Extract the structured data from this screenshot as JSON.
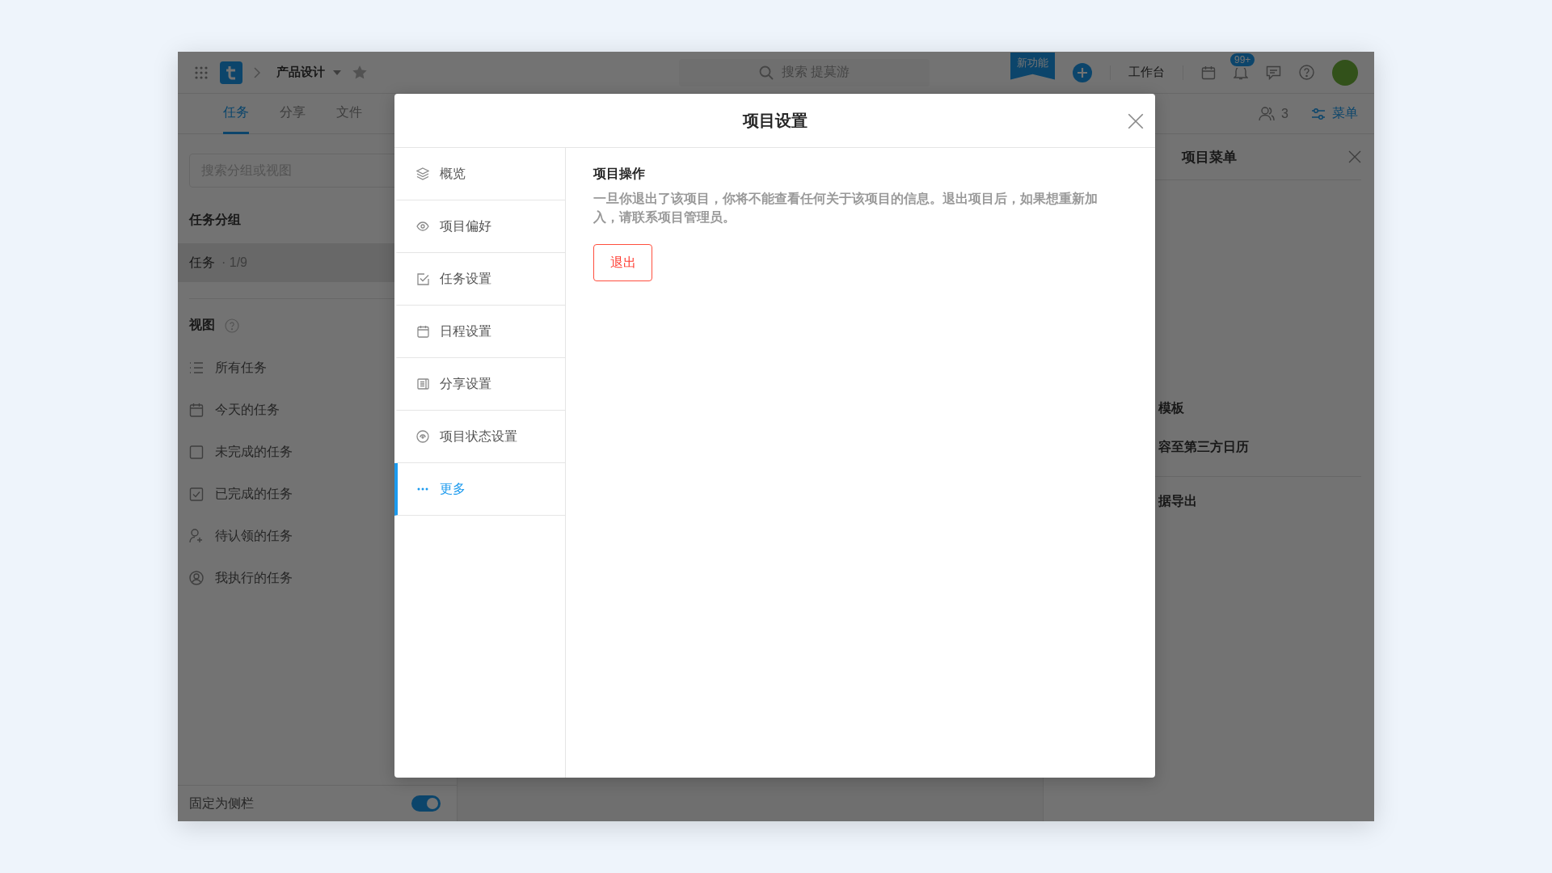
{
  "topbar": {
    "project_name": "产品设计",
    "search_placeholder": "搜索 提莫游",
    "new_feature_badge": "新功能",
    "workbench": "工作台",
    "notification_count": "99+"
  },
  "tabs": [
    {
      "label": "任务",
      "selected": true
    },
    {
      "label": "分享",
      "selected": false
    },
    {
      "label": "文件",
      "selected": false
    }
  ],
  "members_count": "3",
  "menu_button": "菜单",
  "sidebar": {
    "search": {
      "placeholder": "搜索分组或视图"
    },
    "groups_heading": "任务分组",
    "groups": [
      {
        "label": "任务",
        "count": "· 1/9",
        "selected": true
      }
    ],
    "views_heading": "视图",
    "views": [
      {
        "label": "所有任务",
        "kind": "list"
      },
      {
        "label": "今天的任务",
        "kind": "calendar"
      },
      {
        "label": "未完成的任务",
        "kind": "open"
      },
      {
        "label": "已完成的任务",
        "kind": "done"
      },
      {
        "label": "待认领的任务",
        "kind": "claim"
      },
      {
        "label": "我执行的任务",
        "kind": "mine"
      }
    ],
    "pin": {
      "label": "固定为侧栏",
      "on": true
    }
  },
  "menu_panel": {
    "title": "项目菜单",
    "items": [
      {
        "label": "模板"
      },
      {
        "label": "容至第三方日历"
      },
      {
        "label": "据导出"
      }
    ]
  },
  "dialog": {
    "title": "项目设置",
    "nav": [
      {
        "label": "概览",
        "kind": "layers",
        "selected": false
      },
      {
        "label": "项目偏好",
        "kind": "eye",
        "selected": false
      },
      {
        "label": "任务设置",
        "kind": "check",
        "selected": false
      },
      {
        "label": "日程设置",
        "kind": "calendar",
        "selected": false
      },
      {
        "label": "分享设置",
        "kind": "share",
        "selected": false
      },
      {
        "label": "项目状态设置",
        "kind": "status",
        "selected": false
      },
      {
        "label": "更多",
        "kind": "more",
        "selected": true
      }
    ],
    "section_title": "项目操作",
    "description": "一旦你退出了该项目，你将不能查看任何关于该项目的信息。退出项目后，如果想重新加入，请联系项目管理员。",
    "button": "退出"
  }
}
